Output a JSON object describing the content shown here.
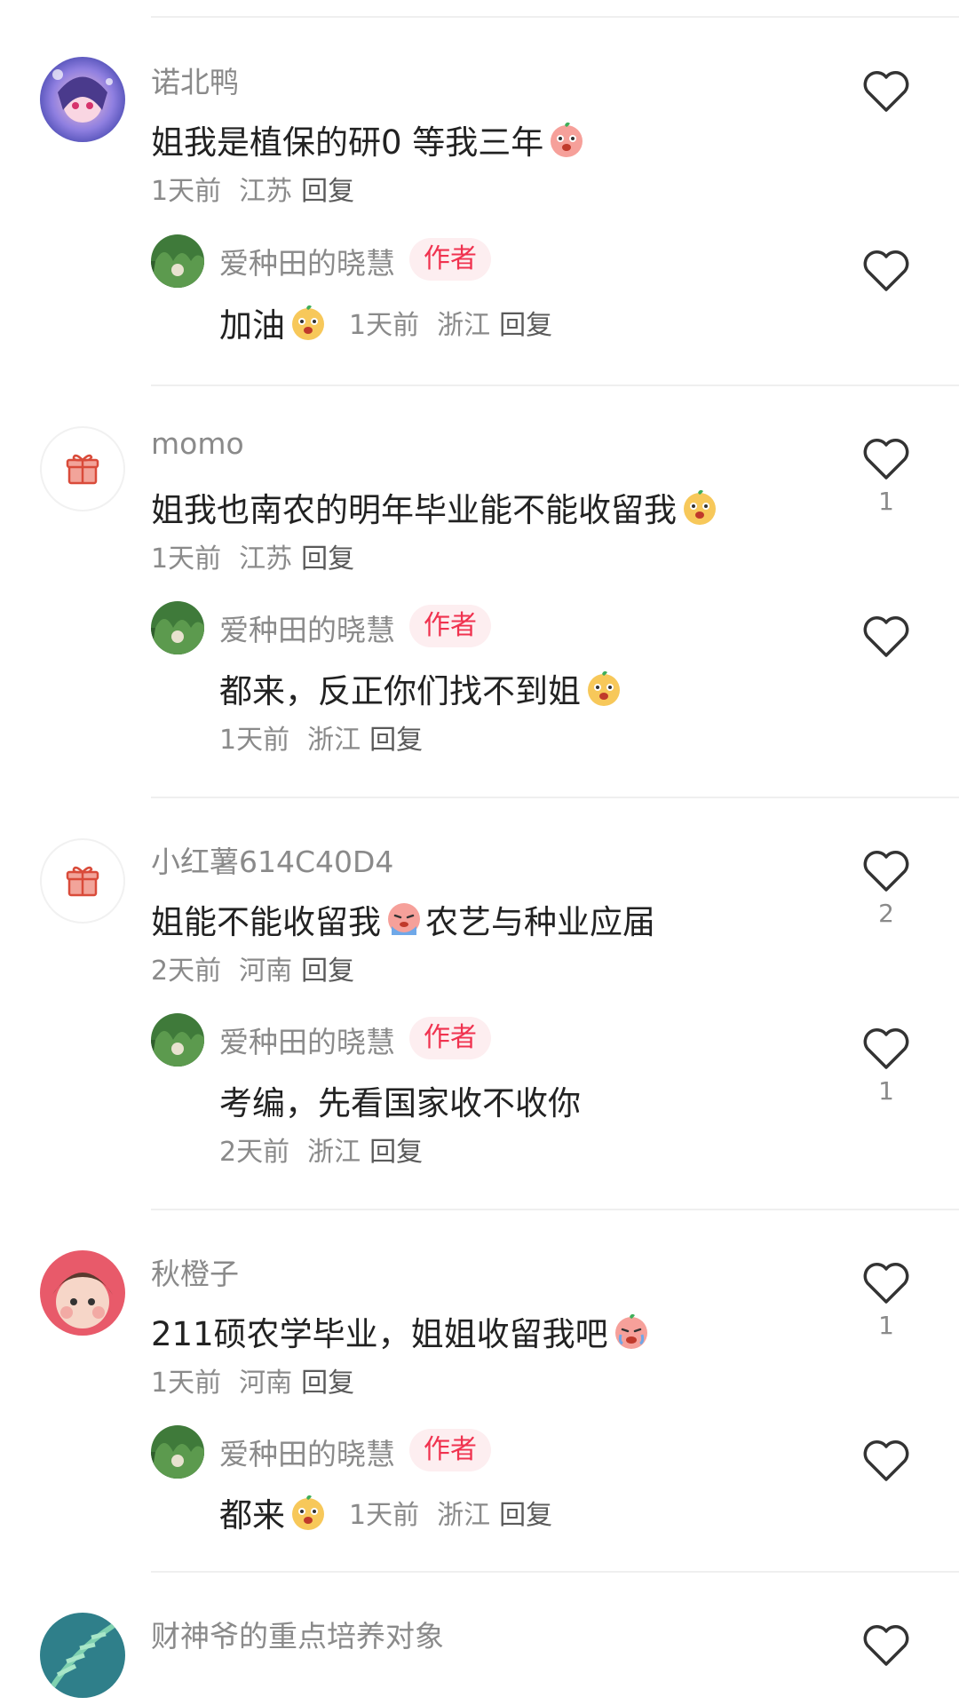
{
  "comments": [
    {
      "username": "诺北鸭",
      "text": "姐我是植保的研0 等我三年",
      "time": "1天前",
      "location": "江苏",
      "reply_label": "回复",
      "like_count": "",
      "reply": {
        "username": "爱种田的晓慧",
        "badge": "作者",
        "text": "加油",
        "time": "1天前",
        "location": "浙江",
        "reply_label": "回复",
        "like_count": ""
      }
    },
    {
      "username": "momo",
      "text": "姐我也南农的明年毕业能不能收留我",
      "time": "1天前",
      "location": "江苏",
      "reply_label": "回复",
      "like_count": "1",
      "reply": {
        "username": "爱种田的晓慧",
        "badge": "作者",
        "text": "都来，反正你们找不到姐",
        "time": "1天前",
        "location": "浙江",
        "reply_label": "回复",
        "like_count": ""
      }
    },
    {
      "username": "小红薯614C40D4",
      "text_before": "姐能不能收留我",
      "text_after": "农艺与种业应届",
      "time": "2天前",
      "location": "河南",
      "reply_label": "回复",
      "like_count": "2",
      "reply": {
        "username": "爱种田的晓慧",
        "badge": "作者",
        "text": "考编，先看国家收不收你",
        "time": "2天前",
        "location": "浙江",
        "reply_label": "回复",
        "like_count": "1"
      }
    },
    {
      "username": "秋橙子",
      "text": "211硕农学毕业，姐姐收留我吧",
      "time": "1天前",
      "location": "河南",
      "reply_label": "回复",
      "like_count": "1",
      "reply": {
        "username": "爱种田的晓慧",
        "badge": "作者",
        "text": "都来",
        "time": "1天前",
        "location": "浙江",
        "reply_label": "回复",
        "like_count": ""
      }
    },
    {
      "username": "财神爷的重点培养对象",
      "like_count": ""
    }
  ],
  "icons": {
    "like": "heart-outline-icon",
    "gift": "gift-icon",
    "emoji_orange": "orange-face-emoji",
    "emoji_pink": "pink-face-emoji",
    "emoji_cry": "crying-face-emoji"
  },
  "colors": {
    "badge_text": "#f0324f",
    "badge_bg": "#fdeef0",
    "meta": "#8a8a8a"
  }
}
